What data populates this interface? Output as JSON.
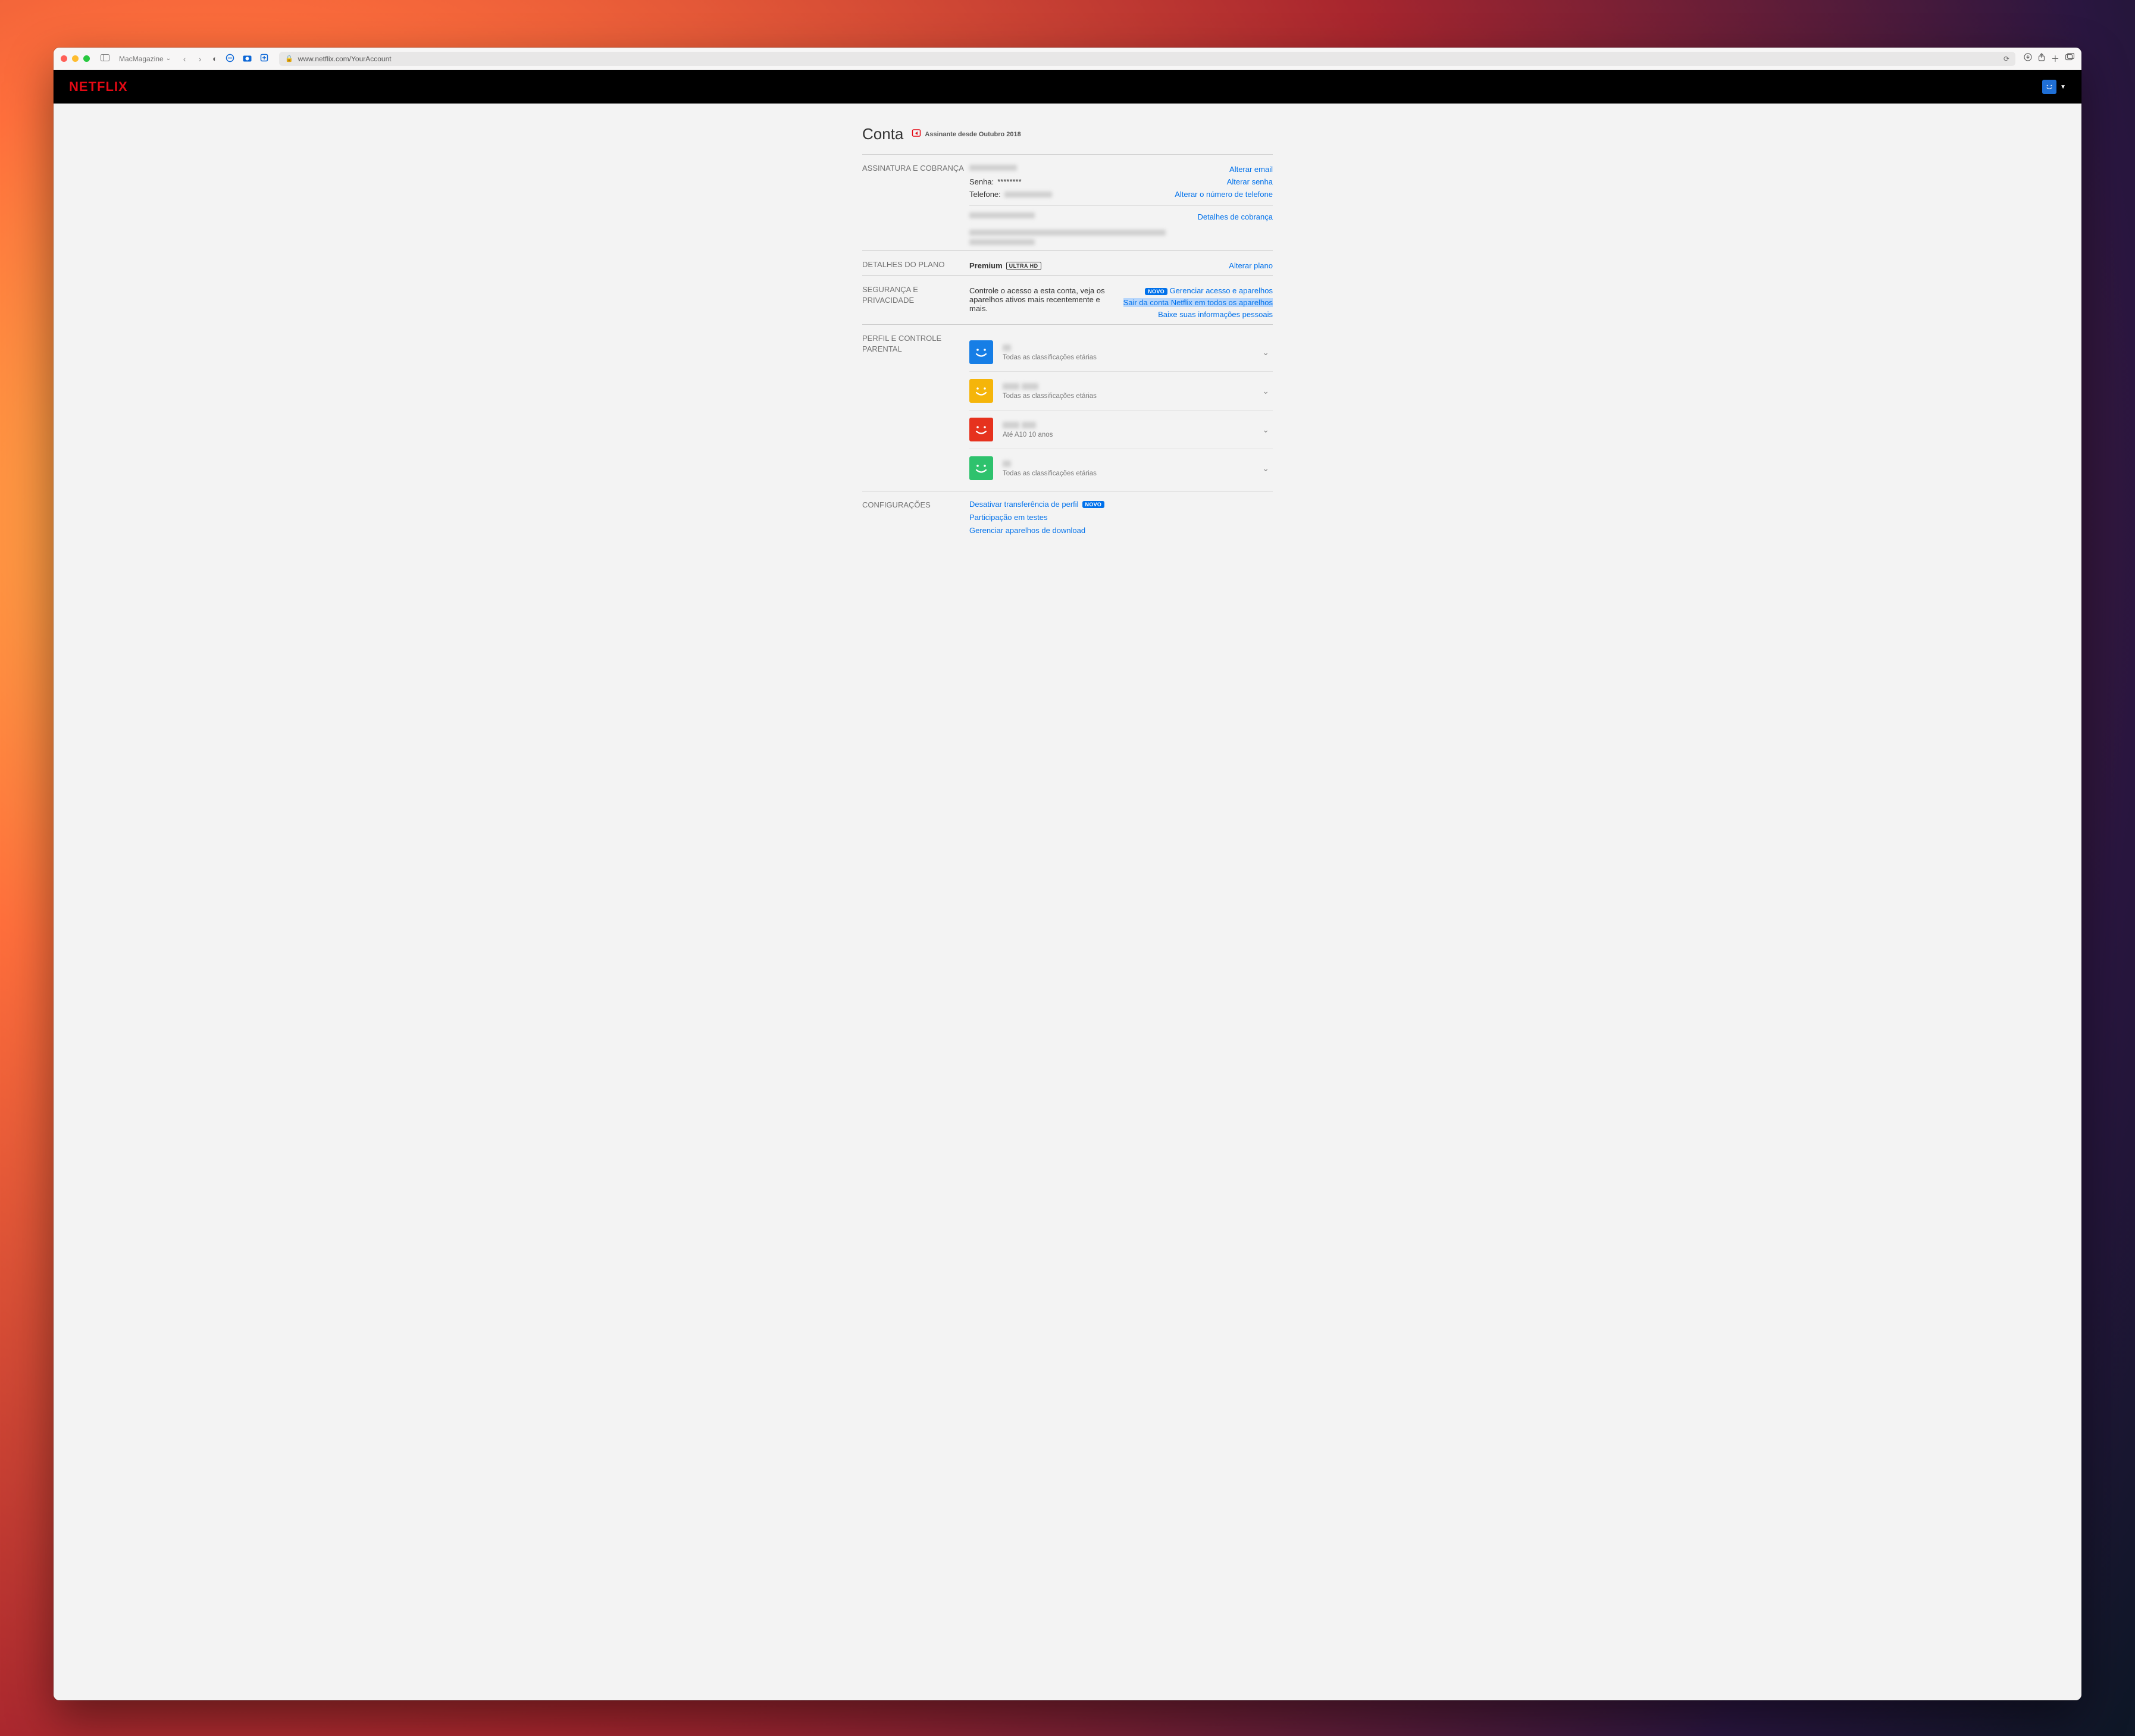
{
  "browser": {
    "tab_group": "MacMagazine",
    "url": "www.netflix.com/YourAccount"
  },
  "header": {
    "logo": "NETFLIX"
  },
  "page": {
    "title": "Conta",
    "member_since_label": "Assinante desde Outubro 2018"
  },
  "membership": {
    "section_label": "ASSINATURA E COBRANÇA",
    "password_label": "Senha:",
    "password_mask": "********",
    "phone_label": "Telefone:",
    "links": {
      "change_email": "Alterar email",
      "change_password": "Alterar senha",
      "change_phone": "Alterar o número de telefone",
      "billing_details": "Detalhes de cobrança"
    }
  },
  "plan": {
    "section_label": "DETALHES DO PLANO",
    "name": "Premium",
    "badge": "ULTRA HD",
    "change_plan": "Alterar plano"
  },
  "security": {
    "section_label": "SEGURANÇA E PRIVACIDADE",
    "description": "Controle o acesso a esta conta, veja os aparelhos ativos mais recentemente e mais.",
    "novo_badge": "NOVO",
    "links": {
      "manage_access": "Gerenciar acesso e aparelhos",
      "sign_out_all": "Sair da conta Netflix em todos os aparelhos",
      "download_info": "Baixe suas informações pessoais"
    }
  },
  "profiles": {
    "section_label": "PERFIL E CONTROLE PARENTAL",
    "all_ratings": "Todas as classificações etárias",
    "kids_rating": "Até A10  10 anos",
    "items": [
      {
        "color": "blue",
        "sub_key": "all_ratings"
      },
      {
        "color": "yellow",
        "sub_key": "all_ratings"
      },
      {
        "color": "red",
        "sub_key": "kids_rating"
      },
      {
        "color": "green",
        "sub_key": "all_ratings"
      }
    ]
  },
  "settings": {
    "section_label": "CONFIGURAÇÕES",
    "novo_badge": "NOVO",
    "links": {
      "disable_profile_transfer": "Desativar transferência de perfil",
      "test_participation": "Participação em testes",
      "manage_download_devices": "Gerenciar aparelhos de download"
    }
  }
}
